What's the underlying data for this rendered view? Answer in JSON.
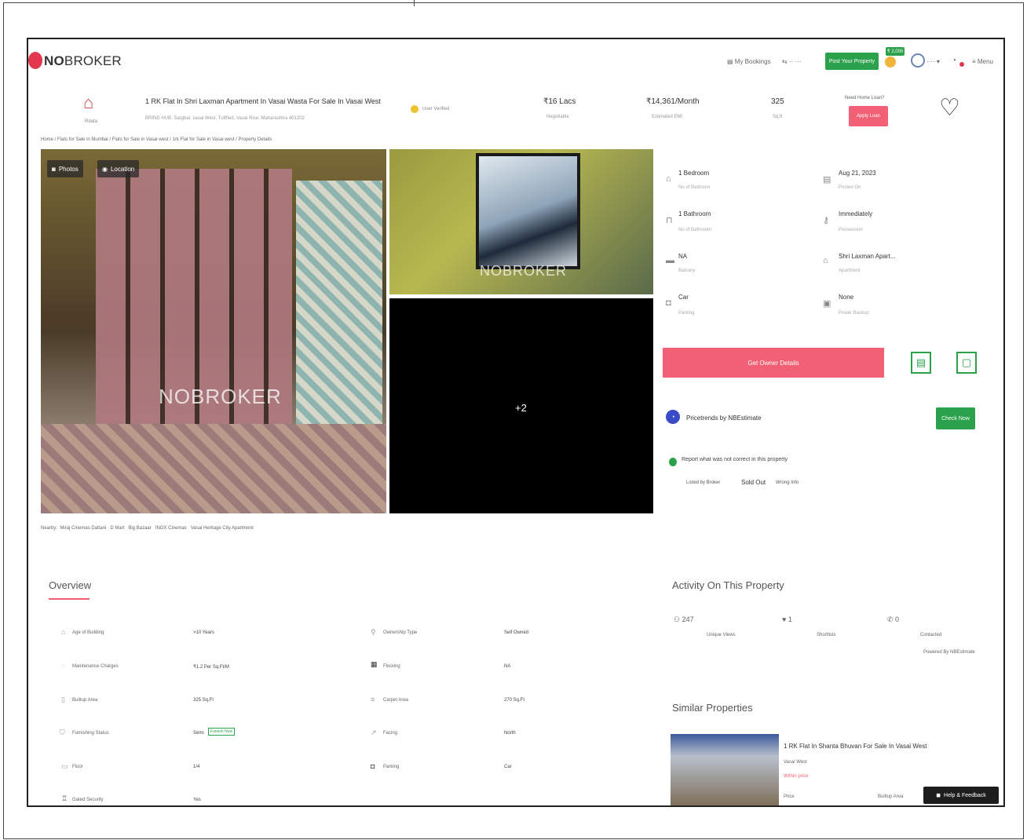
{
  "brand": {
    "logo_prefix": "NO",
    "logo_suffix": "BROKER",
    "accent": "#e3364f",
    "green": "#2ba14b"
  },
  "topnav": {
    "bookings": "My Bookings",
    "post_property": "Post Your Property",
    "coin_badge": "₹ 2,000",
    "menu": "Menu"
  },
  "listing": {
    "title": "1 RK Flat In Shri Laxman Apartment In Vasai Wasta For Sale In Vasai West",
    "verified": "User Verified",
    "price": "₹16 Lacs",
    "price_sub": "Negotiable",
    "emi": "₹14,361/Month",
    "emi_sub": "Estimated EMI",
    "area": "325",
    "area_sub": "Sq.ft",
    "home_loan": "Need Home Loan?",
    "apply_loan": "Apply Loan",
    "breadcrumb": "Home / Flats for Sale in Mumbai / Flats for Sale in Vasai west / 1rk Flat for Sale in Vasai west / Property Details"
  },
  "photos": {
    "photos_btn": "Photos",
    "location_btn": "Location",
    "watermark": "NOBROKER",
    "more": "+2"
  },
  "nearby": {
    "label": "Nearby:",
    "items": [
      "Miraj Cinemas Dattani",
      "D Mart",
      "Big Bazaar",
      "INOX Cinemas",
      "Vasai Heritage City Apartment"
    ]
  },
  "details": [
    {
      "icon": "bed-icon",
      "glyph": "⌂",
      "label": "1 Bedroom",
      "sub": "No of Bedroom"
    },
    {
      "icon": "calendar-icon",
      "glyph": "▤",
      "label": "Aug 21, 2023",
      "sub": "Posted On"
    },
    {
      "icon": "bath-icon",
      "glyph": "⊓",
      "label": "1 Bathroom",
      "sub": "No of Bathroom"
    },
    {
      "icon": "key-icon",
      "glyph": "⚷",
      "label": "Immediately",
      "sub": "Possession"
    },
    {
      "icon": "balcony-icon",
      "glyph": "▬",
      "label": "NA",
      "sub": "Balcony"
    },
    {
      "icon": "building-icon",
      "glyph": "⌂",
      "label": "Shri Laxman Apart...",
      "sub": "Apartment"
    },
    {
      "icon": "car-icon",
      "glyph": "◘",
      "label": "Car",
      "sub": "Parking"
    },
    {
      "icon": "power-icon",
      "glyph": "▣",
      "label": "None",
      "sub": "Power Backup"
    }
  ],
  "actions": {
    "owner_details": "Get Owner Details",
    "pricetrends": "Pricetrends by NBEstimate",
    "check_now": "Check Now",
    "report": "Report what was not correct in this property",
    "listed_by_broker": "Listed by Broker",
    "sold_out": "Sold Out",
    "wrong_info": "Wrong Info"
  },
  "overview": {
    "title": "Overview",
    "rows": [
      {
        "label": "Age of Building",
        "value": ">10 Years",
        "label2": "Ownership Type",
        "value2": "Self Owned"
      },
      {
        "label": "Maintenance Charges",
        "value": "₹1.2 Per Sq.Ft/M",
        "label2": "Flooring",
        "value2": "NA"
      },
      {
        "label": "Builtup Area",
        "value": "325 Sq.Ft",
        "label2": "Carpet Area",
        "value2": "270 Sq.Ft"
      },
      {
        "label": "Furnishing Status",
        "value": "Semi",
        "label2": "Facing",
        "value2": "North"
      },
      {
        "label": "Floor",
        "value": "1/4",
        "label2": "Parking",
        "value2": "Car"
      },
      {
        "label": "Gated Security",
        "value": "Yes",
        "label2": "",
        "value2": ""
      }
    ],
    "furnish_tag": "Furnish Now"
  },
  "activity": {
    "title": "Activity On This Property",
    "views": "247",
    "views_sub": "Unique Views",
    "shortlists": "1",
    "shortlists_sub": "Shortlists",
    "contacted": "0",
    "contacted_sub": "Contacted",
    "powered": "Powered By NBEstimate"
  },
  "similar": {
    "title": "Similar Properties",
    "item_title": "1 RK Flat In Shanta Bhuvan For Sale In Vasai West",
    "item_sub": "Vasai West",
    "item_price": "Within price",
    "item_size": "Price",
    "item_status": "Builtup Area"
  },
  "help": {
    "label": "Help & Feedback"
  }
}
